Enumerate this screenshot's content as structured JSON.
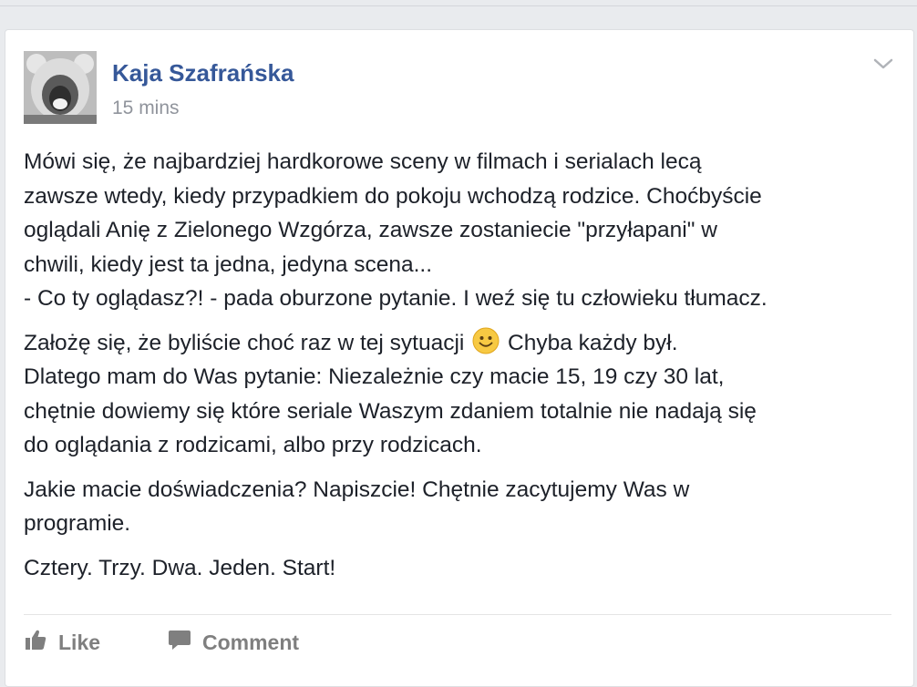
{
  "post": {
    "author": "Kaja Szafrańska",
    "timestamp": "15 mins",
    "paragraphs": [
      [
        "Mówi się, że najbardziej hardkorowe sceny w filmach i serialach lecą",
        "zawsze wtedy, kiedy przypadkiem do pokoju wchodzą rodzice. Choćbyście",
        "oglądali Anię z Zielonego Wzgórza, zawsze zostaniecie \"przyłapani\" w",
        "chwili, kiedy jest ta jedna, jedyna scena...",
        "- Co ty oglądasz?! - pada oburzone pytanie. I weź się tu człowieku tłumacz."
      ],
      {
        "line1_before": "Założę się, że byliście choć raz w tej sytuacji",
        "line1_after": "Chyba każdy był.",
        "lines": [
          "Dlatego mam do Was pytanie: Niezależnie czy macie 15, 19 czy 30 lat,",
          "chętnie dowiemy się które seriale Waszym zdaniem totalnie nie nadają się",
          "do oglądania z rodzicami, albo przy rodzicach."
        ]
      },
      [
        "Jakie macie doświadczenia? Napiszcie! Chętnie zacytujemy Was w",
        "programie."
      ],
      [
        "Cztery. Trzy. Dwa. Jeden. Start!"
      ]
    ],
    "emoji": "smiley-icon"
  },
  "actions": {
    "like_label": "Like",
    "comment_label": "Comment"
  },
  "colors": {
    "author": "#365899",
    "meta": "#90949c",
    "text": "#1d2129",
    "action": "#7f7f7f",
    "emoji": "#f7c943"
  }
}
